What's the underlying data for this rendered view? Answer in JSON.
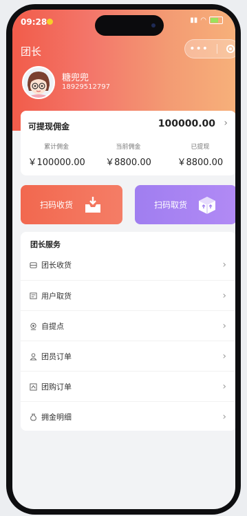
{
  "status_bar": {
    "time": "09:28"
  },
  "nav": {
    "title": "团长",
    "more": "•••"
  },
  "user": {
    "name": "糖兜兜",
    "phone": "18929512797"
  },
  "commission": {
    "title": "可提现佣金",
    "value": "100000.00",
    "stats": [
      {
        "label": "累计佣金",
        "value": "￥100000.00"
      },
      {
        "label": "当前佣金",
        "value": "￥8800.00"
      },
      {
        "label": "已提现",
        "value": "￥8800.00"
      }
    ]
  },
  "actions": {
    "receive": "扫码收货",
    "pickup": "扫码取货"
  },
  "services": {
    "title": "团长服务",
    "items": [
      {
        "label": "团长收货",
        "icon": "receive-box-icon"
      },
      {
        "label": "用户取货",
        "icon": "pickup-icon"
      },
      {
        "label": "自提点",
        "icon": "location-icon"
      },
      {
        "label": "团员订单",
        "icon": "person-icon"
      },
      {
        "label": "团购订单",
        "icon": "order-icon"
      },
      {
        "label": "拥金明细",
        "icon": "money-bag-icon"
      }
    ]
  },
  "colors": {
    "header_start": "#f25c4a",
    "header_end": "#f7b07a",
    "receive_btn": "#f2684f",
    "pickup_btn": "#a07ef0"
  }
}
